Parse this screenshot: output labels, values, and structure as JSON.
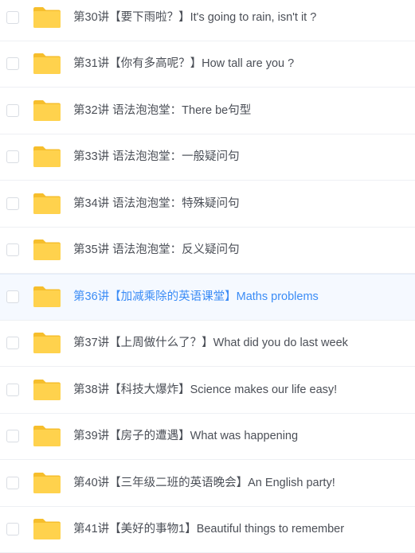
{
  "files": [
    {
      "name": "第30讲【要下雨啦？】It's going to rain, isn't it ?",
      "icon": "folder-icon"
    },
    {
      "name": "第31讲【你有多高呢？】How tall are you ?",
      "icon": "folder-icon"
    },
    {
      "name": "第32讲 语法泡泡堂：There be句型",
      "icon": "folder-icon"
    },
    {
      "name": "第33讲 语法泡泡堂：一般疑问句",
      "icon": "folder-icon"
    },
    {
      "name": "第34讲 语法泡泡堂：特殊疑问句",
      "icon": "folder-icon"
    },
    {
      "name": "第35讲 语法泡泡堂：反义疑问句",
      "icon": "folder-icon"
    },
    {
      "name": "第36讲【加减乘除的英语课堂】Maths problems",
      "icon": "folder-icon",
      "hovered": true
    },
    {
      "name": "第37讲【上周做什么了？】What did you do last week",
      "icon": "folder-icon"
    },
    {
      "name": "第38讲【科技大爆炸】Science makes our life easy!",
      "icon": "folder-icon"
    },
    {
      "name": "第39讲【房子的遭遇】What was happening",
      "icon": "folder-icon"
    },
    {
      "name": "第40讲【三年级二班的英语晚会】An English party!",
      "icon": "folder-icon"
    },
    {
      "name": "第41讲【美好的事物1】Beautiful things to remember",
      "icon": "folder-icon"
    }
  ],
  "colors": {
    "folder_front": "#ffd24d",
    "folder_back": "#f6be2c",
    "text": "#4b4f57",
    "text_hover": "#3b8cf6",
    "row_hover_bg": "#f5f9ff"
  }
}
